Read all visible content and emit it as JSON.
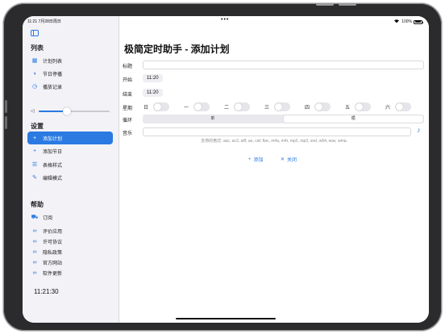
{
  "status_bar": {
    "time": "11:21",
    "date": "7月28日周日",
    "dots": "•••",
    "battery_text": "100%"
  },
  "sidebar": {
    "list_section_title": "列表",
    "list_items": [
      {
        "label": "计划列表",
        "icon": "calendar-icon"
      },
      {
        "label": "节日停播",
        "icon": "speaker-icon"
      },
      {
        "label": "播放记录",
        "icon": "clock-icon"
      }
    ],
    "volume_level": 0.4,
    "settings_section_title": "设置",
    "settings_items": [
      {
        "label": "添加计划",
        "icon": "plus-icon",
        "active": true
      },
      {
        "label": "添加节日",
        "icon": "plus-icon"
      },
      {
        "label": "表格样式",
        "icon": "list-icon"
      },
      {
        "label": "编辑模式",
        "icon": "pencil-icon"
      }
    ],
    "help_section_title": "帮助",
    "help_items": [
      {
        "label": "订阅",
        "icon": "cart-icon"
      },
      {
        "label": "评价应用",
        "icon": "link-icon"
      },
      {
        "label": "许可协议",
        "icon": "link-icon"
      },
      {
        "label": "隐私政策",
        "icon": "link-icon"
      },
      {
        "label": "官方网站",
        "icon": "link-icon"
      },
      {
        "label": "软件更新",
        "icon": "link-icon"
      }
    ],
    "clock": "11:21:30"
  },
  "form": {
    "page_title": "极简定时助手 - 添加计划",
    "title_label": "标题",
    "title_value": "",
    "start_label": "开始",
    "start_value": "11:20",
    "end_label": "结束",
    "end_value": "11:20",
    "weekday_label": "星期",
    "weekdays": [
      "日",
      "一",
      "二",
      "三",
      "四",
      "五",
      "六"
    ],
    "loop_label": "循环",
    "loop_options": [
      "单",
      "循"
    ],
    "loop_selected": 1,
    "music_label": "音乐",
    "formats_text": "支持的格式: aac, ac3, aiff, au, caf, flac, m4a, m4r, mp2, mp3, snd, w64, wav, wma.",
    "add_label": "添加",
    "close_label": "关闭"
  },
  "colors": {
    "accent": "#2a7ae2",
    "sidebar_bg": "#f2f2f7"
  }
}
